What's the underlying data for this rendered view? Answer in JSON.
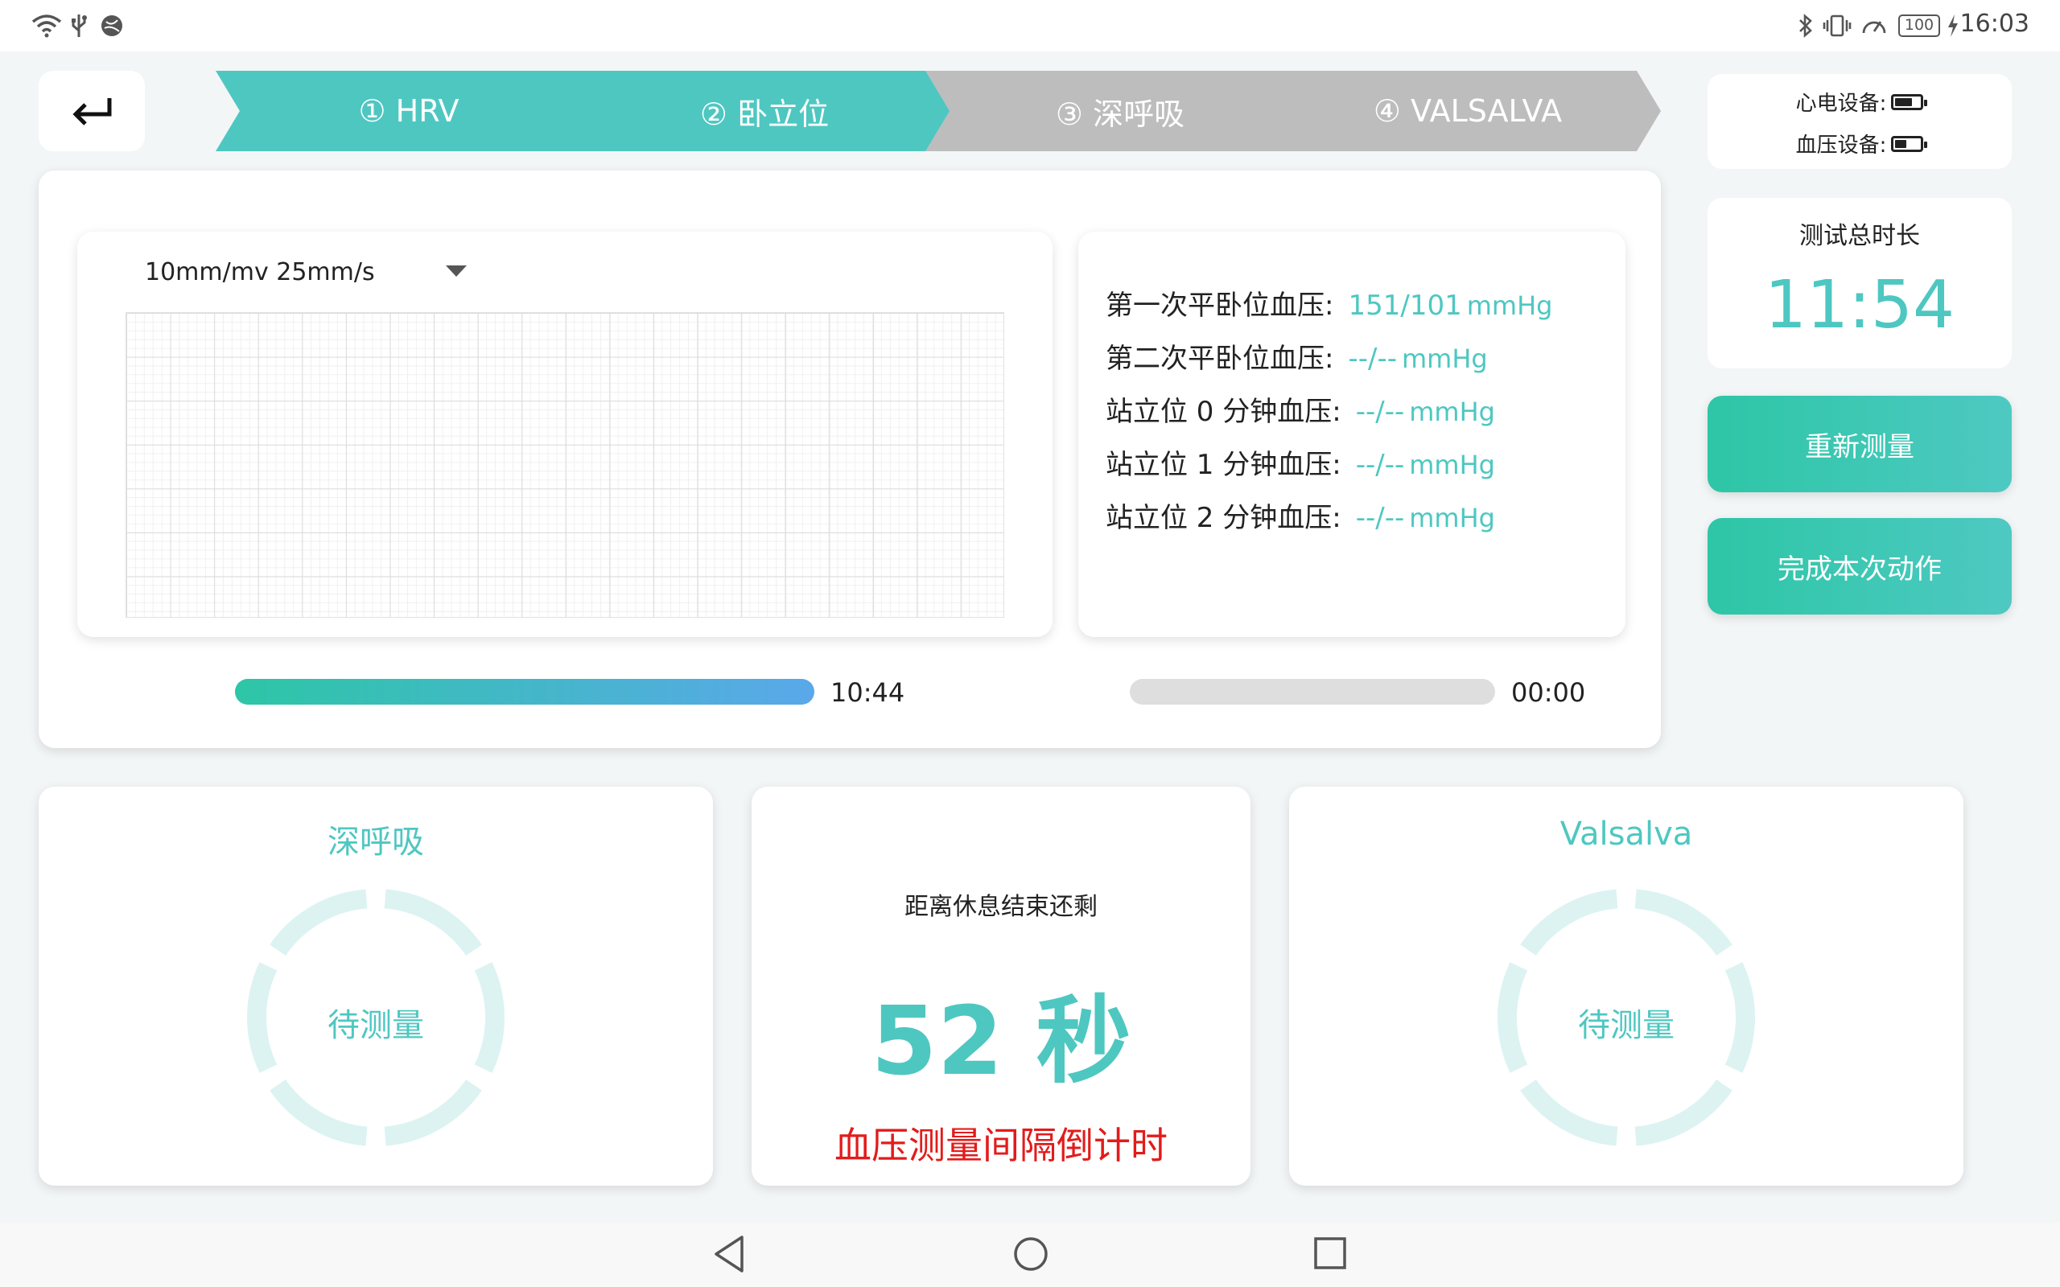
{
  "status_bar": {
    "time": "16:03",
    "battery_level": "100",
    "icons": [
      "wifi-icon",
      "usb-icon",
      "vpn-icon",
      "bluetooth-icon",
      "vibrate-icon",
      "data-speed-icon",
      "battery-icon",
      "charging-icon"
    ]
  },
  "steps": [
    {
      "label": "① HRV",
      "state": "active"
    },
    {
      "label": "② 卧立位",
      "state": "active"
    },
    {
      "label": "③ 深呼吸",
      "state": "inactive"
    },
    {
      "label": "④ VALSALVA",
      "state": "inactive"
    }
  ],
  "devices": {
    "ecg_label": "心电设备:",
    "bp_label": "血压设备:",
    "ecg_battery_fraction": 0.7,
    "bp_battery_fraction": 0.45
  },
  "total_time": {
    "label": "测试总时长",
    "value": "11:54"
  },
  "buttons": {
    "remeasure": "重新测量",
    "finish": "完成本次动作"
  },
  "ecg": {
    "scale_option": "10mm/mv 25mm/s"
  },
  "bp_readings": [
    {
      "label": "第一次平卧位血压:",
      "value": "151/101",
      "unit": "mmHg"
    },
    {
      "label": "第二次平卧位血压:",
      "value": "--/--",
      "unit": "mmHg"
    },
    {
      "label": "站立位 0 分钟血压:",
      "value": "--/--",
      "unit": "mmHg"
    },
    {
      "label": "站立位 1 分钟血压:",
      "value": "--/--",
      "unit": "mmHg"
    },
    {
      "label": "站立位 2 分钟血压:",
      "value": "--/--",
      "unit": "mmHg"
    }
  ],
  "progress": {
    "first": {
      "time": "10:44",
      "fraction": 1.0
    },
    "second": {
      "time": "00:00",
      "fraction": 0.0
    }
  },
  "deep_breath": {
    "title": "深呼吸",
    "status": "待测量"
  },
  "countdown": {
    "label": "距离休息结束还剩",
    "value": "52 秒",
    "caption": "血压测量间隔倒计时"
  },
  "valsalva": {
    "title": "Valsalva",
    "status": "待测量"
  },
  "colors": {
    "accent": "#4ec7c1",
    "inactive": "#bdbdbd",
    "alert": "#e31b1b",
    "ring": "#dcf3f2"
  }
}
